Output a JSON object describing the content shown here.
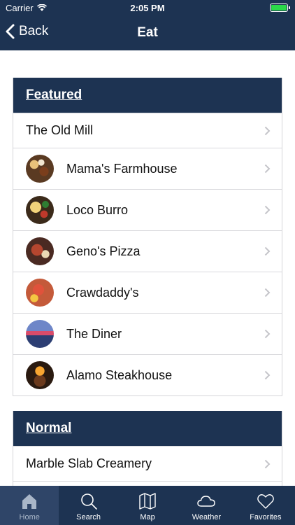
{
  "status_bar": {
    "carrier": "Carrier",
    "time": "2:05 PM"
  },
  "nav": {
    "back_label": "Back",
    "title": "Eat"
  },
  "sections": {
    "featured": {
      "title": "Featured",
      "items": [
        {
          "name": "The Old Mill"
        },
        {
          "name": "Mama's Farmhouse",
          "thumb": "food-thumbnail"
        },
        {
          "name": "Loco Burro",
          "thumb": "food-thumbnail"
        },
        {
          "name": "Geno's Pizza",
          "thumb": "food-thumbnail"
        },
        {
          "name": "Crawdaddy's",
          "thumb": "food-thumbnail"
        },
        {
          "name": "The Diner",
          "thumb": "food-thumbnail"
        },
        {
          "name": "Alamo Steakhouse",
          "thumb": "food-thumbnail"
        }
      ]
    },
    "normal": {
      "title": "Normal",
      "items": [
        {
          "name": "Marble Slab Creamery"
        }
      ]
    }
  },
  "tabs": [
    {
      "label": "Home",
      "icon": "home-icon",
      "active": true
    },
    {
      "label": "Search",
      "icon": "search-icon"
    },
    {
      "label": "Map",
      "icon": "map-icon"
    },
    {
      "label": "Weather",
      "icon": "cloud-icon"
    },
    {
      "label": "Favorites",
      "icon": "heart-icon"
    }
  ],
  "colors": {
    "bar": "#1d3352",
    "active_tab": "#2f4568",
    "battery": "#2bd94a"
  }
}
